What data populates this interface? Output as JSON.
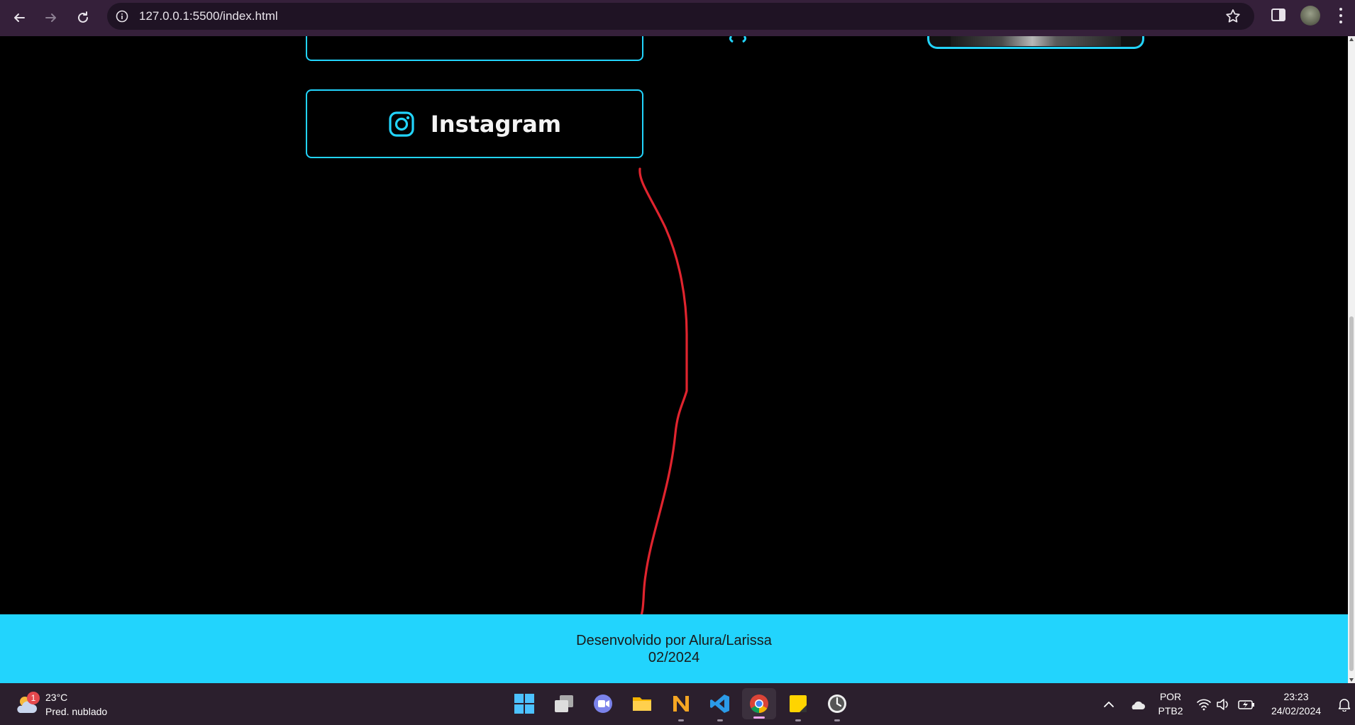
{
  "browser": {
    "url": "127.0.0.1:5500/index.html"
  },
  "page": {
    "instagram_label": "Instagram",
    "footer": {
      "line1": "Desenvolvido por Alura/Larissa",
      "line2": "02/2024"
    },
    "colors": {
      "accent": "#22d4fd",
      "background": "#000000",
      "annotation": "#e0242e"
    }
  },
  "taskbar": {
    "weather": {
      "badge": "1",
      "temp": "23°C",
      "desc": "Pred. nublado"
    },
    "apps": [
      "start-icon",
      "task-view-icon",
      "chat-icon",
      "file-explorer-icon",
      "app-n-icon",
      "vscode-icon",
      "chrome-icon",
      "sticky-notes-icon",
      "clock-icon"
    ],
    "language_line1": "POR",
    "language_line2": "PTB2",
    "time": "23:23",
    "date": "24/02/2024"
  }
}
